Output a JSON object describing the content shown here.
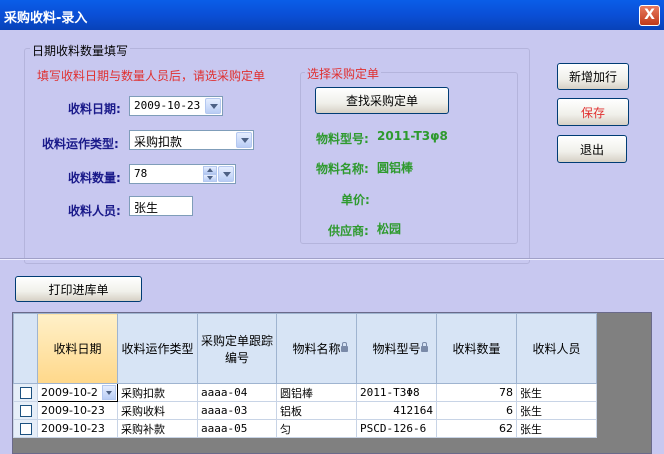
{
  "window": {
    "title": "采购收料-录入",
    "close_glyph": "X"
  },
  "form": {
    "group_title": "日期收料数量填写",
    "hint": "填写收料日期与数量人员后，请选采购定单",
    "date_label": "收料日期:",
    "date_value": "2009-10-23",
    "type_label": "收料运作类型:",
    "type_value": "采购扣款",
    "qty_label": "收料数量:",
    "qty_value": "78",
    "person_label": "收料人员:",
    "person_value": "张生"
  },
  "order": {
    "group_title": "选择采购定单",
    "find_button": "查找采购定单",
    "model_label": "物料型号:",
    "model_value": "2011-T3φ8",
    "name_label": "物料名称:",
    "name_value": "圆铝棒",
    "price_label": "单价:",
    "price_value": "",
    "supplier_label": "供应商:",
    "supplier_value": "松园"
  },
  "actions": {
    "add": "新增加行",
    "save": "保存",
    "exit": "退出",
    "print": "打印进库单"
  },
  "grid": {
    "headers": [
      "收料日期",
      "收料运作类型",
      "采购定单跟踪编号",
      "物料名称",
      "物料型号",
      "收料数量",
      "收料人员"
    ],
    "rows": [
      [
        "2009-10-2",
        "采购扣款",
        "aaaa-04",
        "圆铝棒",
        "2011-T3Φ8",
        "78",
        "张生"
      ],
      [
        "2009-10-23",
        "采购收料",
        "aaaa-03",
        "铝板",
        "412164",
        "6",
        "张生"
      ],
      [
        "2009-10-23",
        "采购补款",
        "aaaa-05",
        "匀",
        "PSCD-126-6",
        "62",
        "张生"
      ]
    ]
  },
  "colors": {
    "background": "#c8c8f0",
    "label_blue": "#1a1a8a",
    "hint_red": "#e03030",
    "value_green": "#2e9a2e",
    "title_bar": "#0a5ee8"
  }
}
